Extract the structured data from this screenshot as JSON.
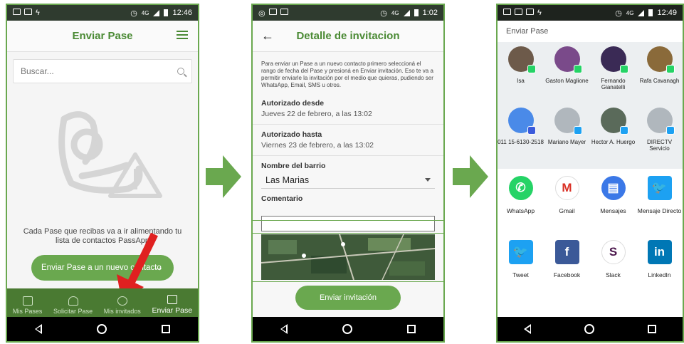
{
  "screens": {
    "p1": {
      "status_time": "12:46",
      "status_net": "4G",
      "title": "Enviar Pase",
      "search_placeholder": "Buscar...",
      "empty_text": "Cada Pase que recibas va a ir alimentando tu lista de contactos PassApp",
      "cta_label": "Enviar Pase a un nuevo contacto",
      "nav": [
        {
          "label": "Mis Pases"
        },
        {
          "label": "Solicitar Pase"
        },
        {
          "label": "Mis invitados"
        },
        {
          "label": "Enviar Pase"
        }
      ]
    },
    "p2": {
      "status_time": "1:02",
      "status_net": "4G",
      "title": "Detalle de invitacion",
      "intro": "Para enviar un Pase a un nuevo contacto primero seleccioná el rango de fecha del Pase y presioná en Enviar invitación. Eso te va a permitir enviarle la invitación por el medio que quieras, pudiendo ser WhatsApp, Email, SMS u otros.",
      "from_label": "Autorizado desde",
      "from_value": "Jueves 22 de febrero, a las 13:02",
      "to_label": "Autorizado hasta",
      "to_value": "Viernes 23 de febrero, a las 13:02",
      "barrio_label": "Nombre del barrio",
      "barrio_value": "Las Marias",
      "comment_label": "Comentario",
      "send_label": "Enviar invitación"
    },
    "p3": {
      "status_time": "12:49",
      "status_net": "4G",
      "sheet_title": "Enviar Pase",
      "contacts": [
        {
          "name": "Isa",
          "color": "#6d5a4a",
          "badge": "#25d366"
        },
        {
          "name": "Gaston Maglione",
          "color": "#7a4a8a",
          "badge": "#25d366"
        },
        {
          "name": "Fernando Gianatelli",
          "color": "#3a2a55",
          "badge": "#25d366"
        },
        {
          "name": "Rafa Cavanagh",
          "color": "#8a6a3a",
          "badge": "#25d366"
        },
        {
          "name": "011 15-6130-2518",
          "color": "#4a8ae8",
          "badge": "#3b5bdb"
        },
        {
          "name": "Mariano Mayer",
          "color": "#b0b7bd",
          "badge": "#1da1f2"
        },
        {
          "name": "Hector A. Huergo",
          "color": "#5a6a5a",
          "badge": "#1da1f2"
        },
        {
          "name": "DIRECTV Servicio",
          "color": "#b0b7bd",
          "badge": "#1da1f2"
        }
      ],
      "apps": [
        {
          "name": "WhatsApp",
          "color": "#25d366",
          "glyph": "✆"
        },
        {
          "name": "Gmail",
          "color": "#ffffff",
          "glyph": "M"
        },
        {
          "name": "Mensajes",
          "color": "#3b78e7",
          "glyph": "▤"
        },
        {
          "name": "Mensaje Directo",
          "color": "#1da1f2",
          "glyph": "🐦"
        },
        {
          "name": "Tweet",
          "color": "#1da1f2",
          "glyph": "🐦"
        },
        {
          "name": "Facebook",
          "color": "#3b5998",
          "glyph": "f"
        },
        {
          "name": "Slack",
          "color": "#ffffff",
          "glyph": "S"
        },
        {
          "name": "LinkedIn",
          "color": "#0077b5",
          "glyph": "in"
        }
      ]
    }
  },
  "colors": {
    "brand_green": "#6aa84f",
    "dark_green": "#4a7a32",
    "arrow_red": "#e02020"
  }
}
